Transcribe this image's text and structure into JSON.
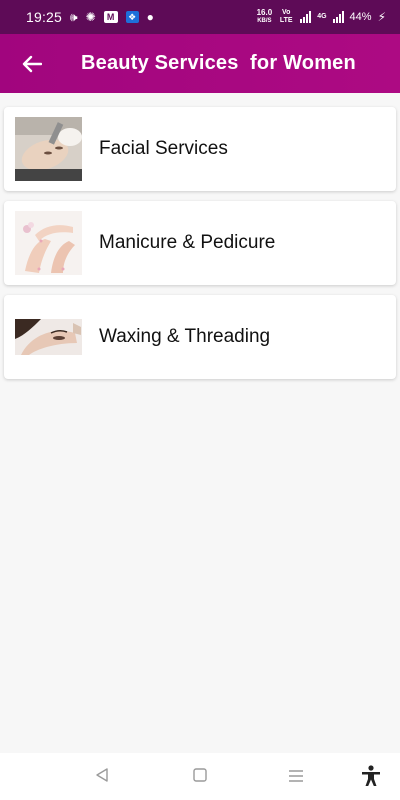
{
  "status_bar": {
    "time": "19:25",
    "icons": [
      "volume-icon",
      "fan-icon",
      "app-icon",
      "vpn-icon",
      "dot-icon"
    ],
    "speed": "16.0",
    "speed_unit": "KB/S",
    "network": "Vo LTE",
    "network_type": "4G",
    "battery": "44%"
  },
  "app_bar": {
    "back_icon": "arrow-left-icon",
    "title": "Beauty Services  for Women",
    "color": "#a1057e"
  },
  "services": [
    {
      "label": "Facial Services",
      "image": "facial-thumbnail"
    },
    {
      "label": "Manicure & Pedicure",
      "image": "manicure-thumbnail"
    },
    {
      "label": "Waxing & Threading",
      "image": "waxing-thumbnail"
    }
  ],
  "nav_bar": {
    "back": "triangle-back-icon",
    "home": "square-home-icon",
    "recents": "menu-lines-icon",
    "accessibility": "accessibility-icon"
  }
}
